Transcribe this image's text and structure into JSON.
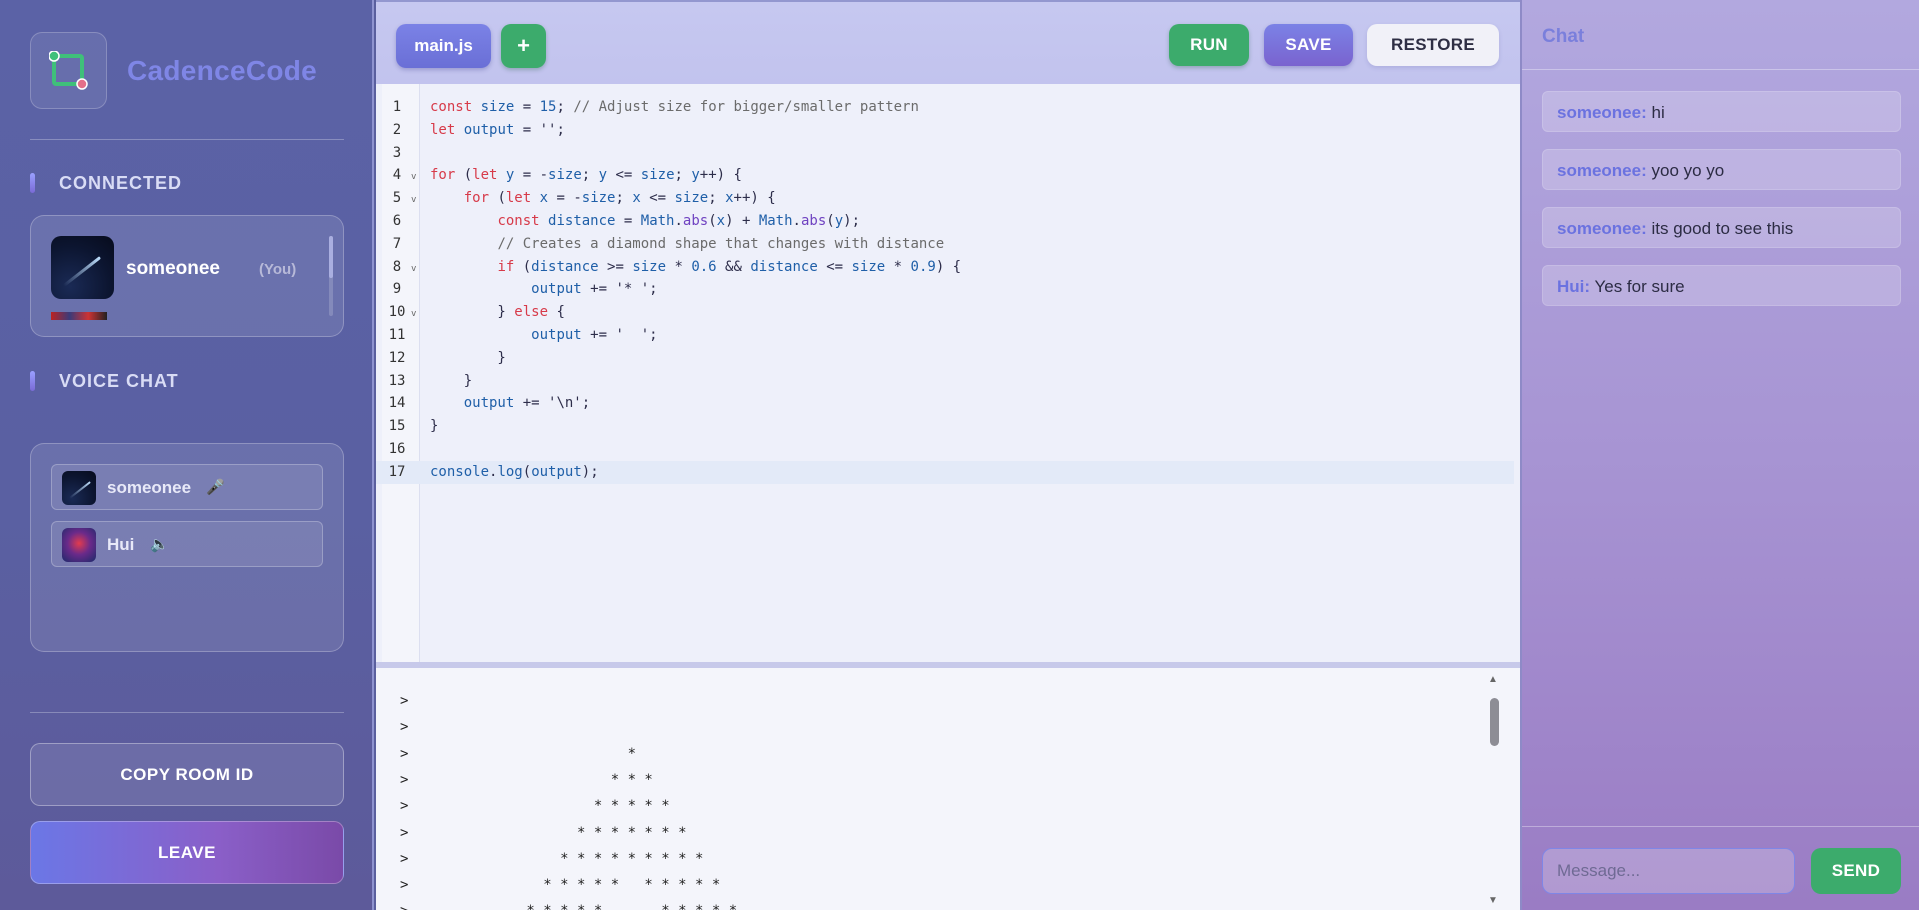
{
  "app": {
    "name": "CadenceCode"
  },
  "sidebar": {
    "connected_title": "CONNECTED",
    "connected_user": {
      "name": "someonee",
      "tag": "(You)"
    },
    "voice_title": "VOICE CHAT",
    "voice_users": [
      {
        "name": "someonee",
        "icon": "🎤"
      },
      {
        "name": "Hui",
        "icon": "🔈"
      }
    ],
    "copy_room_label": "COPY ROOM ID",
    "leave_label": "LEAVE"
  },
  "toolbar": {
    "file_tab": "main.js",
    "add_label": "+",
    "run_label": "RUN",
    "save_label": "SAVE",
    "restore_label": "RESTORE"
  },
  "editor": {
    "lines": [
      "const size = 15; // Adjust size for bigger/smaller pattern",
      "let output = '';",
      "",
      "for (let y = -size; y <= size; y++) {",
      "    for (let x = -size; x <= size; x++) {",
      "        const distance = Math.abs(x) + Math.abs(y);",
      "        // Creates a diamond shape that changes with distance",
      "        if (distance >= size * 0.6 && distance <= size * 0.9) {",
      "            output += '* ';",
      "        } else {",
      "            output += '  ';",
      "        }",
      "    }",
      "    output += '\\n';",
      "}",
      "",
      "console.log(output);"
    ],
    "fold_lines": [
      4,
      5,
      8,
      10
    ],
    "active_line": 17
  },
  "console": {
    "lines": [
      ">",
      ">",
      ">                          *",
      ">                        * * *",
      ">                      * * * * *",
      ">                    * * * * * * *",
      ">                  * * * * * * * * *",
      ">                * * * * *   * * * * *",
      ">              * * * * *       * * * * *"
    ]
  },
  "chat": {
    "title": "Chat",
    "messages": [
      {
        "user": "someonee:",
        "text": "hi"
      },
      {
        "user": "someonee:",
        "text": "yoo yo yo"
      },
      {
        "user": "someonee:",
        "text": "its good to see this"
      },
      {
        "user": "Hui:",
        "text": "Yes for sure"
      }
    ],
    "input_placeholder": "Message...",
    "send_label": "SEND"
  }
}
